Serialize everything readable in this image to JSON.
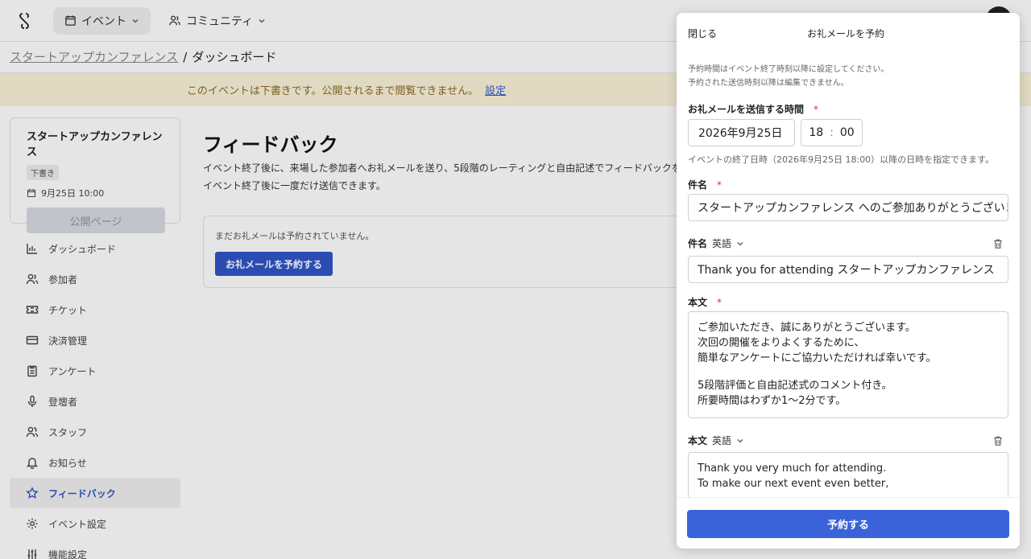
{
  "topbar": {
    "logo": "swirl-logo-icon",
    "nav": [
      {
        "label": "イベント",
        "icon": "calendar-icon",
        "active": true
      },
      {
        "label": "コミュニティ",
        "icon": "users-icon",
        "active": false
      }
    ]
  },
  "breadcrumb": {
    "link": "スタートアップカンファレンス",
    "separator": "/",
    "current": "ダッシュボード"
  },
  "banner": {
    "text": "このイベントは下書きです。公開されるまで閲覧できません。",
    "link": "設定"
  },
  "event_card": {
    "title": "スタートアップカンファレンス",
    "badge": "下書き",
    "date": "9月25日 10:00",
    "public_button": "公開ページ"
  },
  "sidebar": {
    "items": [
      {
        "label": "ダッシュボード",
        "icon": "bar-chart-icon"
      },
      {
        "label": "参加者",
        "icon": "users-icon"
      },
      {
        "label": "チケット",
        "icon": "ticket-icon"
      },
      {
        "label": "決済管理",
        "icon": "credit-card-icon"
      },
      {
        "label": "アンケート",
        "icon": "clipboard-icon"
      },
      {
        "label": "登壇者",
        "icon": "microphone-icon"
      },
      {
        "label": "スタッフ",
        "icon": "staff-icon"
      },
      {
        "label": "お知らせ",
        "icon": "bell-icon"
      },
      {
        "label": "フィードバック",
        "icon": "star-icon",
        "active": true
      },
      {
        "label": "イベント設定",
        "icon": "gear-icon"
      },
      {
        "label": "機能設定",
        "icon": "sliders-icon"
      }
    ]
  },
  "main": {
    "title": "フィードバック",
    "desc_line1": "イベント終了後に、来場した参加者へお礼メールを送り、5段階のレーティングと自由記述でフィードバックを",
    "desc_line2": "イベント終了後に一度だけ送信できます。",
    "empty_text": "まだお礼メールは予約されていません。",
    "schedule_button": "お礼メールを予約する"
  },
  "modal": {
    "close": "閉じる",
    "title": "お礼メールを予約",
    "note_line1": "予約時間はイベント終了時刻以降に設定してください。",
    "note_line2": "予約された送信時刻以降は編集できません。",
    "send_time_label": "お礼メールを送信する時間",
    "required_mark": "*",
    "date_value": "2026年9月25日",
    "hour_value": "18",
    "time_sep": ":",
    "minute_value": "00",
    "hint": "イベントの終了日時（2026年9月25日 18:00）以降の日時を指定できます。",
    "subject_label": "件名",
    "subject_value": "スタートアップカンファレンス へのご参加ありがとうございました",
    "subject_en_label": "件名",
    "lang_en": "英語",
    "subject_en_value": "Thank you for attending スタートアップカンファレンス",
    "body_label": "本文",
    "body_lines": [
      "ご参加いただき、誠にありがとうございます。",
      "次回の開催をよりよくするために、",
      "簡単なアンケートにご協力いただければ幸いです。",
      "5段階評価と自由記述式のコメント付き。",
      "所要時間はわずか1〜2分です。"
    ],
    "body_en_label": "本文",
    "body_en_lines": [
      "Thank you very much for attending.",
      "To make our next event even better,"
    ],
    "submit": "予約する"
  },
  "colors": {
    "accent": "#2f55c8",
    "banner_bg": "#fbf3d9",
    "required": "#d33333"
  }
}
